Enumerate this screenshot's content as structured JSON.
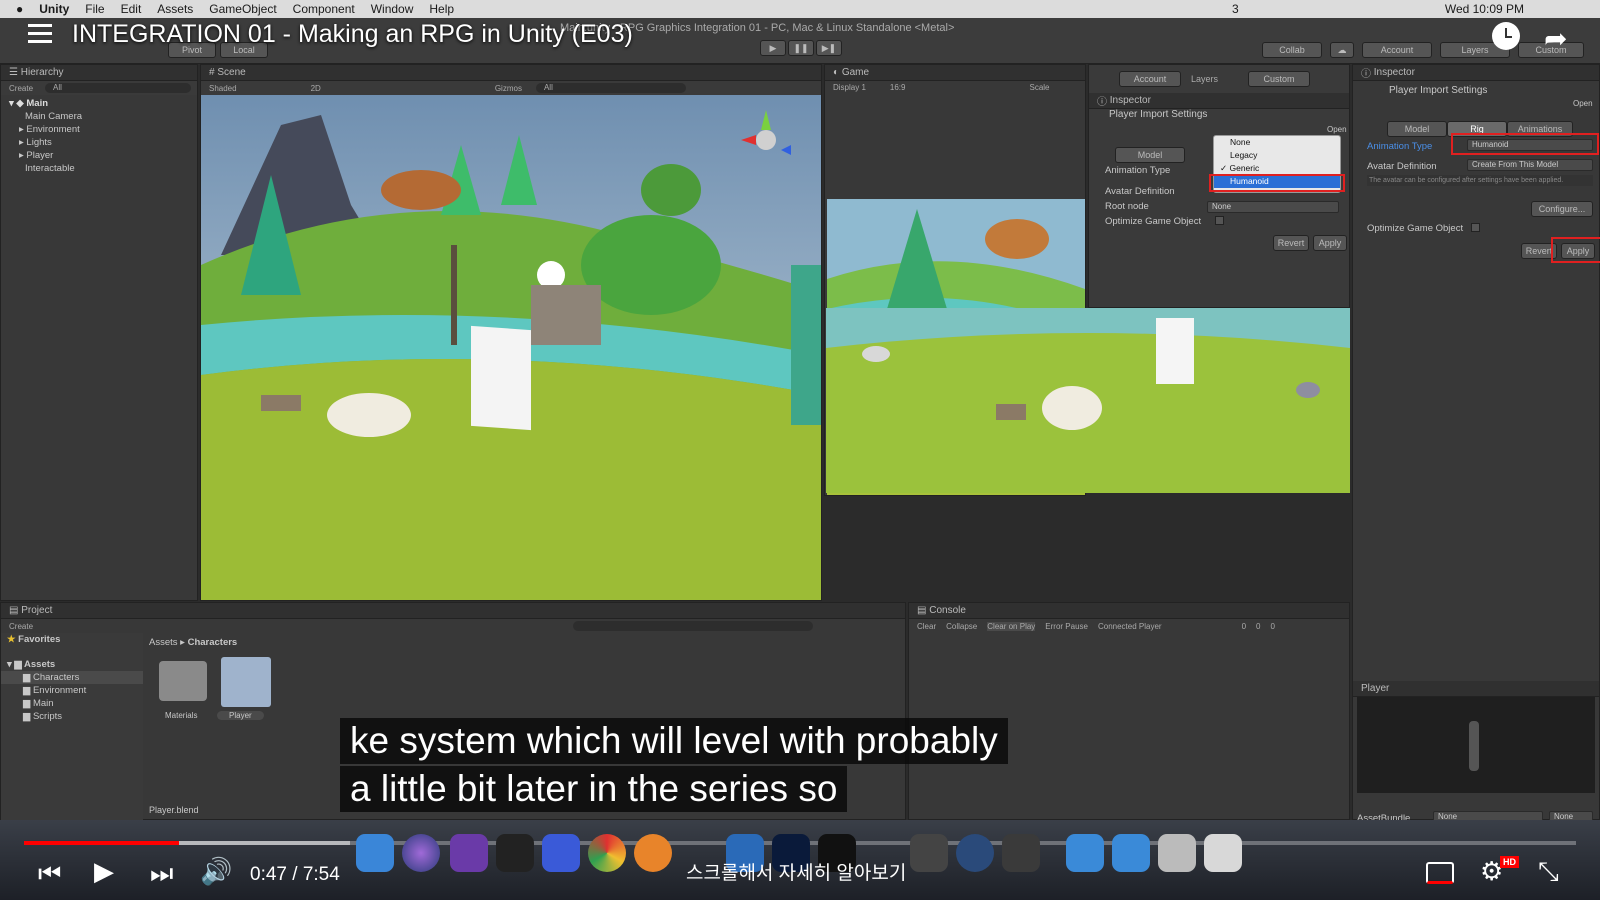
{
  "menubar": {
    "apple": "",
    "items": [
      "Unity",
      "File",
      "Edit",
      "Assets",
      "GameObject",
      "Component",
      "Window",
      "Help"
    ],
    "clock": "Wed 10:09 PM",
    "extra": "3"
  },
  "video": {
    "title": "INTEGRATION 01 - Making an RPG in Unity (E03)",
    "time": "0:47 / 7:54",
    "caption_line1": "ke system which will level with probably",
    "caption_line2": "a little bit later in the series so",
    "korean_hint": "스크롤해서 자세히 알아보기",
    "progress": 0.1,
    "buffered": 0.21
  },
  "unity": {
    "window_title": "Main.unity - RPG Graphics Integration 01 - PC, Mac & Linux Standalone <Metal>",
    "toolbar": {
      "pivot": "Pivot",
      "local": "Local",
      "collab": "Collab",
      "account": "Account",
      "layers": "Layers",
      "layout": "Custom"
    },
    "hierarchy": {
      "title": "Hierarchy",
      "create": "Create",
      "search": "All",
      "scene": "Main",
      "items": [
        "Main Camera",
        "Environment",
        "Lights",
        "Player",
        "Interactable"
      ]
    },
    "scene": {
      "title": "Scene",
      "shading": "Shaded",
      "mode2d": "2D",
      "gizmos": "Gizmos",
      "search": "All"
    },
    "game": {
      "title": "Game",
      "display": "Display 1",
      "aspect": "16:9",
      "scale": "Scale"
    },
    "inspector_small": {
      "title": "Inspector",
      "header": "Player Import Settings",
      "open": "Open",
      "tab_model": "Model",
      "animation_type": "Animation Type",
      "avatar_definition": "Avatar Definition",
      "root_node": "Root node",
      "root_value": "None",
      "optimize": "Optimize Game Object",
      "revert": "Revert",
      "apply": "Apply",
      "dropdown": [
        "None",
        "Legacy",
        "Generic",
        "Humanoid"
      ],
      "checked": "Generic",
      "account": "Account",
      "layers": "Layers",
      "custom": "Custom"
    },
    "inspector": {
      "title": "Inspector",
      "header": "Player Import Settings",
      "open": "Open",
      "tabs": [
        "Model",
        "Rig",
        "Animations"
      ],
      "animation_type": "Animation Type",
      "animation_value": "Humanoid",
      "avatar_definition": "Avatar Definition",
      "avatar_value": "Create From This Model",
      "note": "The avatar can be configured after settings have been applied.",
      "configure": "Configure...",
      "optimize": "Optimize Game Object",
      "revert": "Revert",
      "apply": "Apply",
      "preview_title": "Player",
      "assetbundle": "AssetBundle",
      "assetbundle_value": "None",
      "variant_value": "None"
    },
    "project": {
      "title": "Project",
      "create": "Create",
      "favorites": "Favorites",
      "assets": "Assets",
      "folders": [
        "Characters",
        "Environment",
        "Main",
        "Scripts"
      ],
      "breadcrumb": [
        "Assets",
        "Characters"
      ],
      "files": [
        "Materials",
        "Player"
      ],
      "footer": "Player.blend"
    },
    "console": {
      "title": "Console",
      "buttons": [
        "Clear",
        "Collapse",
        "Clear on Play",
        "Error Pause",
        "Connected Player"
      ],
      "counts": [
        "0",
        "0",
        "0"
      ]
    }
  },
  "colors": {
    "accent": "#e02020",
    "selection": "#2b6fd6",
    "ytred": "#ff0000"
  }
}
